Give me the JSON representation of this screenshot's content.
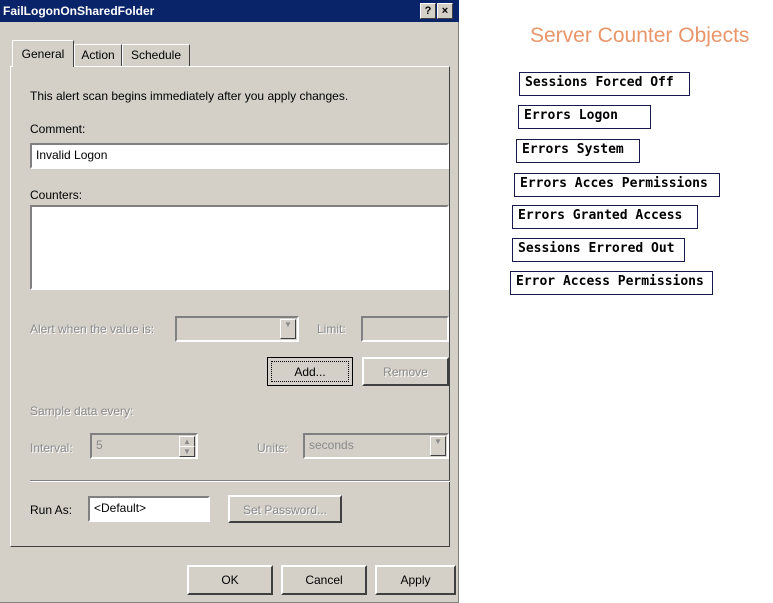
{
  "dialog": {
    "title": "FailLogonOnSharedFolder",
    "help_button": "?",
    "close_button": "×",
    "tabs": [
      {
        "label": "General"
      },
      {
        "label": "Action"
      },
      {
        "label": "Schedule"
      }
    ],
    "intro_text": "This alert scan begins immediately after you apply changes.",
    "comment_label": "Comment:",
    "comment_value": "Invalid Logon",
    "counters_label": "Counters:",
    "alert_label": "Alert when the value is:",
    "limit_label": "Limit:",
    "add_button": "Add...",
    "remove_button": "Remove",
    "sample_label": "Sample data every:",
    "interval_label": "Interval:",
    "interval_value": "5",
    "units_label": "Units:",
    "units_value": "seconds",
    "run_as_label": "Run As:",
    "run_as_value": "<Default>",
    "set_password_button": "Set Password...",
    "ok_button": "OK",
    "cancel_button": "Cancel",
    "apply_button": "Apply"
  },
  "annotations": {
    "title": "Server Counter Objects",
    "items": [
      "Sessions Forced Off",
      "Errors Logon",
      "Errors System",
      "Errors Acces Permissions",
      "Errors Granted Access",
      "Sessions Errored Out",
      "Error Access Permissions"
    ]
  },
  "colors": {
    "titlebar": "#0a246a",
    "dialog_face": "#d4d0c8",
    "annotation_title": "#e8966a"
  }
}
